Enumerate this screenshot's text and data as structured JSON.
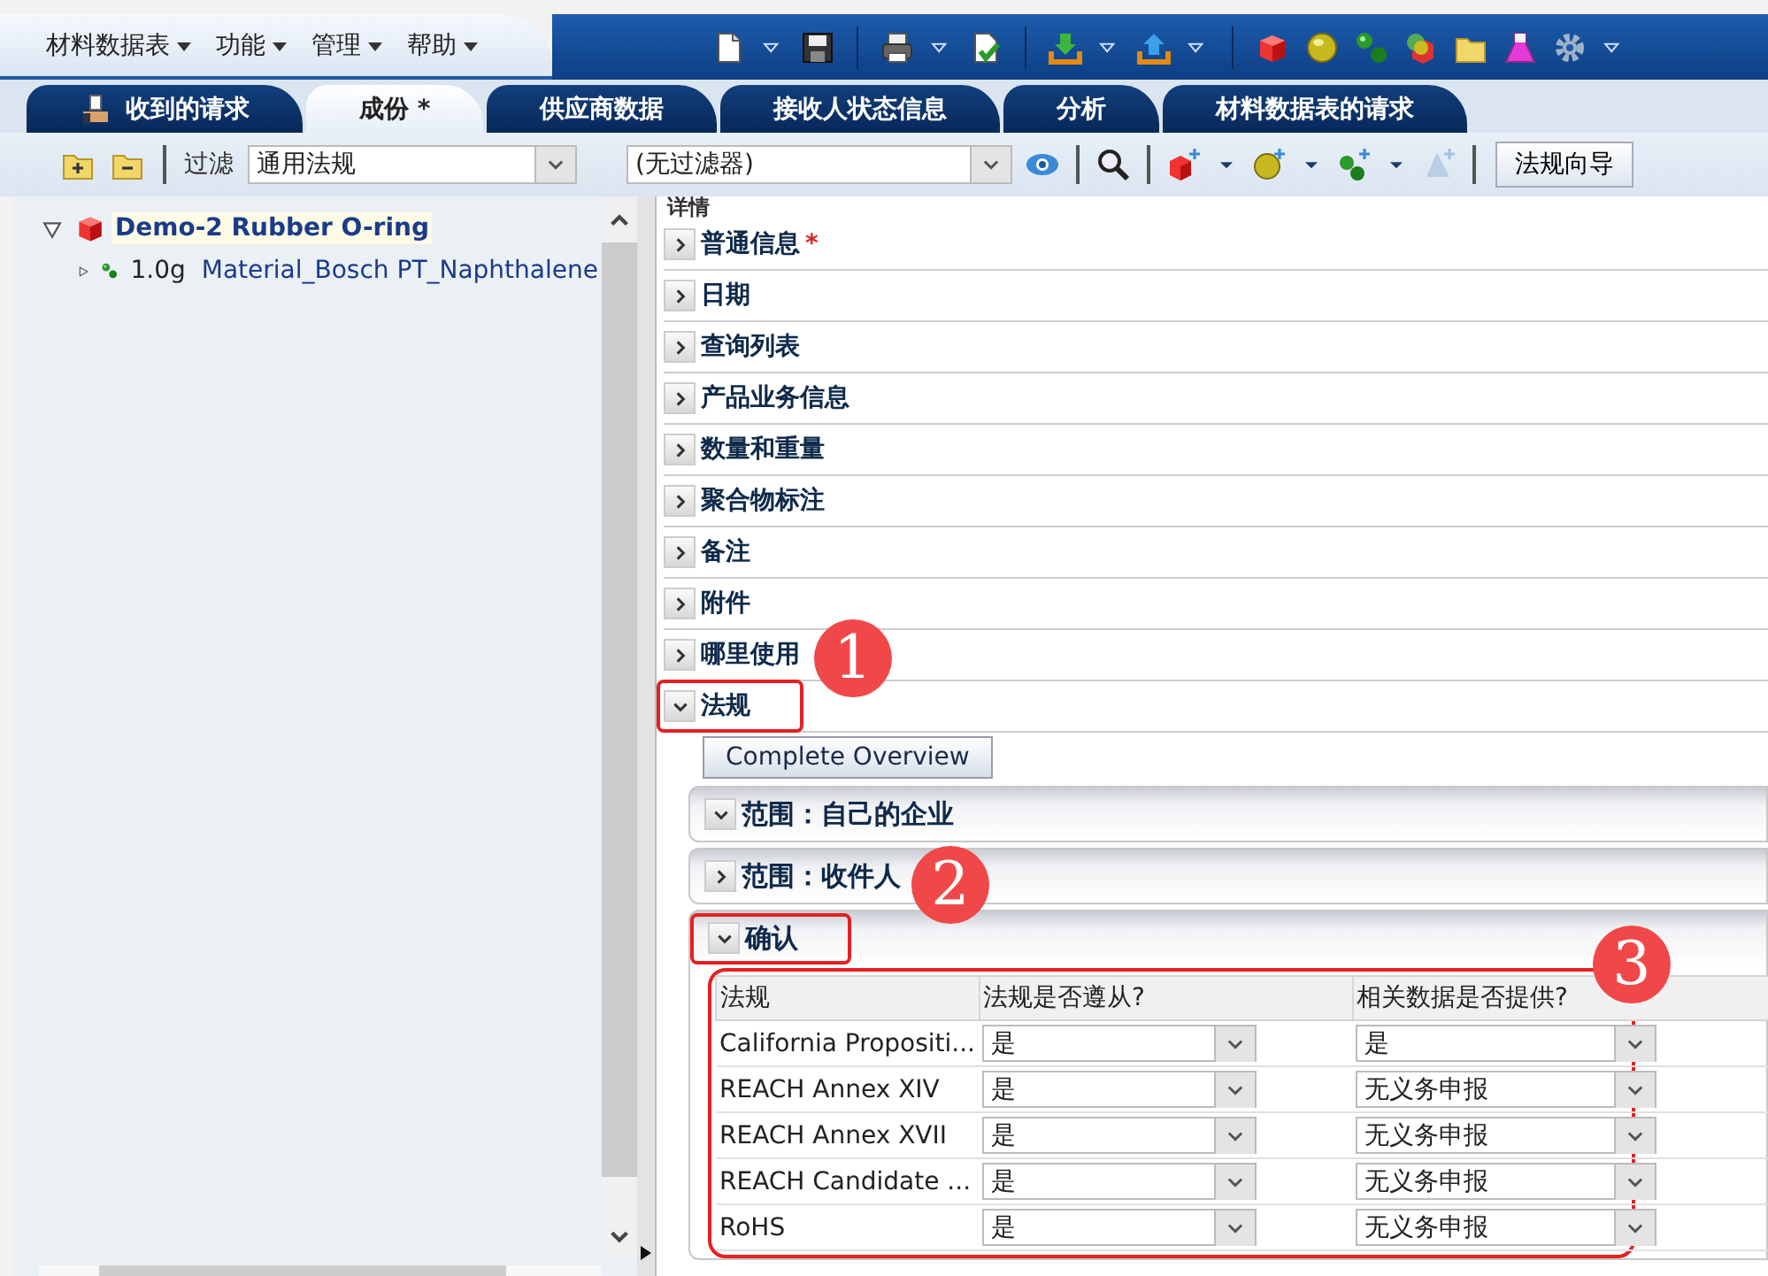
{
  "menu": [
    {
      "label": "材料数据表"
    },
    {
      "label": "功能"
    },
    {
      "label": "管理"
    },
    {
      "label": "帮助"
    }
  ],
  "tabs": [
    {
      "label": "收到的请求",
      "selected": false,
      "kind": "icon"
    },
    {
      "label": "成份 *",
      "selected": true,
      "kind": "plain"
    },
    {
      "label": "供应商数据",
      "selected": false,
      "kind": "plain"
    },
    {
      "label": "接收人状态信息",
      "selected": false,
      "kind": "plain"
    },
    {
      "label": "分析",
      "selected": false,
      "kind": "plain"
    },
    {
      "label": "材料数据表的请求",
      "selected": false,
      "kind": "plain"
    }
  ],
  "filter": {
    "label": "过滤",
    "value": "通用法规"
  },
  "filter2": {
    "value": "(无过滤器)"
  },
  "wizard_button": "法规向导",
  "tree": [
    {
      "label": "Demo-2 Rubber O-ring",
      "expanded": true,
      "selected": true,
      "children": [
        {
          "quantity": "1.0g",
          "label": "Material_Bosch PT_Naphthalene",
          "expanded": false,
          "selected": false
        }
      ]
    }
  ],
  "details": {
    "title": "详情",
    "sections": [
      {
        "label": "普通信息",
        "expanded": false,
        "required_mark": "*"
      },
      {
        "label": "日期",
        "expanded": false
      },
      {
        "label": "查询列表",
        "expanded": false
      },
      {
        "label": "产品业务信息",
        "expanded": false
      },
      {
        "label": "数量和重量",
        "expanded": false
      },
      {
        "label": "聚合物标注",
        "expanded": false
      },
      {
        "label": "备注",
        "expanded": false
      },
      {
        "label": "附件",
        "expanded": false
      },
      {
        "label": "哪里使用",
        "expanded": false
      },
      {
        "label": "法规",
        "expanded": true,
        "callout": "1"
      }
    ],
    "overview_button": "Complete Overview",
    "subsections": [
      {
        "label": "范围：自己的企业",
        "expanded": true
      },
      {
        "label": "范围：收件人",
        "expanded": false
      },
      {
        "label": "确认",
        "expanded": true,
        "callout": "2"
      }
    ],
    "table": {
      "callout": "3",
      "columns": [
        "法规",
        "法规是否遵从?",
        "相关数据是否提供?"
      ],
      "rows": [
        {
          "regulation": "California Propositi...",
          "compliant": "是",
          "data_provided": "是"
        },
        {
          "regulation": "REACH Annex XIV",
          "compliant": "是",
          "data_provided": "无义务申报"
        },
        {
          "regulation": "REACH Annex XVII",
          "compliant": "是",
          "data_provided": "无义务申报"
        },
        {
          "regulation": "REACH Candidate ...",
          "compliant": "是",
          "data_provided": "无义务申报"
        },
        {
          "regulation": "RoHS",
          "compliant": "是",
          "data_provided": "无义务申报"
        }
      ]
    }
  }
}
